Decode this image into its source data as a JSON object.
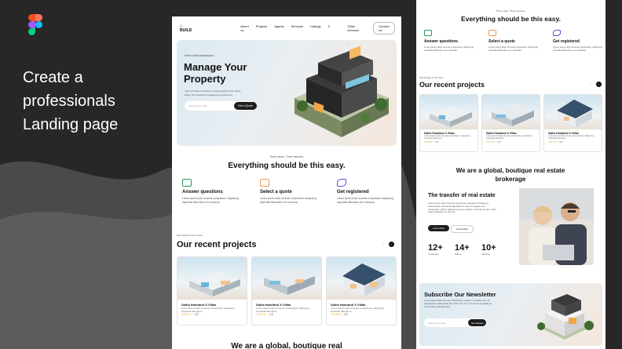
{
  "headline": [
    "Create a",
    "professionals",
    "Landing page"
  ],
  "colors": {
    "background": "#272727",
    "logo": [
      "#f24e1e",
      "#ff7262",
      "#a259ff",
      "#1abcfe",
      "#0acf83"
    ],
    "feature_icons": [
      "#1f9d55",
      "#f2994a",
      "#5b4bdb"
    ],
    "stars": "#f5a623"
  },
  "landing": {
    "nav": {
      "brand": "BUILD",
      "links": [
        "About us",
        "Projects",
        "Agents",
        "Services",
        "Listings"
      ],
      "other": "Other services",
      "cta": "Contact us"
    },
    "hero": {
      "kicker": "Real estate Marketplace",
      "title": "Manage Your Property",
      "description": "Your AI house everything coming together here, faster, better, the seamless management experience.",
      "email_placeholder": "Enter your email",
      "button": "Get a Quote"
    },
    "features_kicker": "Three steps. Three minutes.",
    "features_title": "Everything should be this easy.",
    "features": [
      {
        "icon": "chat-icon",
        "title": "Answer questions",
        "desc": "Lorem ipsum dolor sit amet consectetur. Adipiscing imperdiet bibendum et in vehicula."
      },
      {
        "icon": "mail-icon",
        "title": "Select a quote",
        "desc": "Lorem ipsum dolor sit amet consectetur. Adipiscing imperdiet bibendum et in vehicula."
      },
      {
        "icon": "pen-icon",
        "title": "Get registered",
        "desc": "Lorem ipsum dolor sit amet consectetur. Adipiscing imperdiet bibendum et in vehicula."
      }
    ],
    "projects_kicker": "Best Project of the Years",
    "projects_title": "Our recent projects",
    "projects": [
      {
        "title": "Saiha Hoarland X Villas",
        "desc": "Lorem ipsum dolor sit amet consectetur. Adipiscing imperdiet bibendum.",
        "stars": "★★★★☆",
        "rating": "4.5"
      },
      {
        "title": "Saiha Hoarland X Villas",
        "desc": "Lorem ipsum dolor sit amet consectetur. Adipiscing imperdiet bibendum.",
        "stars": "★★★★☆",
        "rating": "4.5"
      },
      {
        "title": "Saiha Hoarland X Villas",
        "desc": "Lorem ipsum dolor sit amet consectetur. Adipiscing imperdiet bibendum.",
        "stars": "★★★★☆",
        "rating": "4.5"
      }
    ],
    "bottom_cut": "We are a global, boutique real"
  },
  "landing2": {
    "features_kicker": "Three steps. Three minutes.",
    "features_title": "Everything should be this easy.",
    "features": [
      {
        "title": "Answer questions",
        "desc": "Lorem ipsum dolor sit amet consectetur. Adipiscing imperdiet bibendum et in vehicula."
      },
      {
        "title": "Select a quote",
        "desc": "Lorem ipsum dolor sit amet consectetur. Adipiscing imperdiet bibendum et in vehicula."
      },
      {
        "title": "Get registered",
        "desc": "Lorem ipsum dolor sit amet consectetur. Adipiscing imperdiet bibendum et in vehicula."
      }
    ],
    "projects_kicker": "Best Project of the Years",
    "projects_title": "Our recent projects",
    "projects": [
      {
        "title": "Saiha Hoarland X Villas",
        "desc": "Lorem ipsum dolor sit amet consectetur. Adipiscing imperdiet bibendum.",
        "stars": "★★★★☆",
        "rating": "4.5"
      },
      {
        "title": "Saiha Hoarland X Villas",
        "desc": "Lorem ipsum dolor sit amet consectetur. Adipiscing imperdiet bibendum.",
        "stars": "★★★★☆",
        "rating": "4.5"
      },
      {
        "title": "Saiha Hoarland X Villas",
        "desc": "Lorem ipsum dolor sit amet consectetur. Adipiscing imperdiet bibendum.",
        "stars": "★★★★☆",
        "rating": "4.5"
      }
    ],
    "global_title": "We are a global, boutique real estate brokerage",
    "transfer_title": "The transfer of real estate",
    "transfer_desc": "Lorem ipsum dolor sit amet consectetur. Egestas in tristique et pellentesque. Sed lacus dignissim ac. Nunc a congue nunc consectetur. Velit et adipiscing sed eu ultrices. Imperdiet semper. Duis. Vitae vestibulum mi nisl nisl.",
    "btn_primary": "Learn More",
    "btn_secondary": "Know More",
    "stats": [
      {
        "value": "12+",
        "label": "Customers"
      },
      {
        "value": "14+",
        "label": "Offices"
      },
      {
        "value": "10+",
        "label": "Students"
      }
    ],
    "newsletter_title": "Subscribe Our Newsletter",
    "newsletter_desc": "Lorem ipsum dolor sit amet consectetur. Integer in molestie nunc at pellentesque. Malesuada dis morbi nunc non. Commodo in sagittis ac cursus felis nulla dignissim.",
    "newsletter_placeholder": "Enter your email",
    "newsletter_button": "Get Started"
  }
}
